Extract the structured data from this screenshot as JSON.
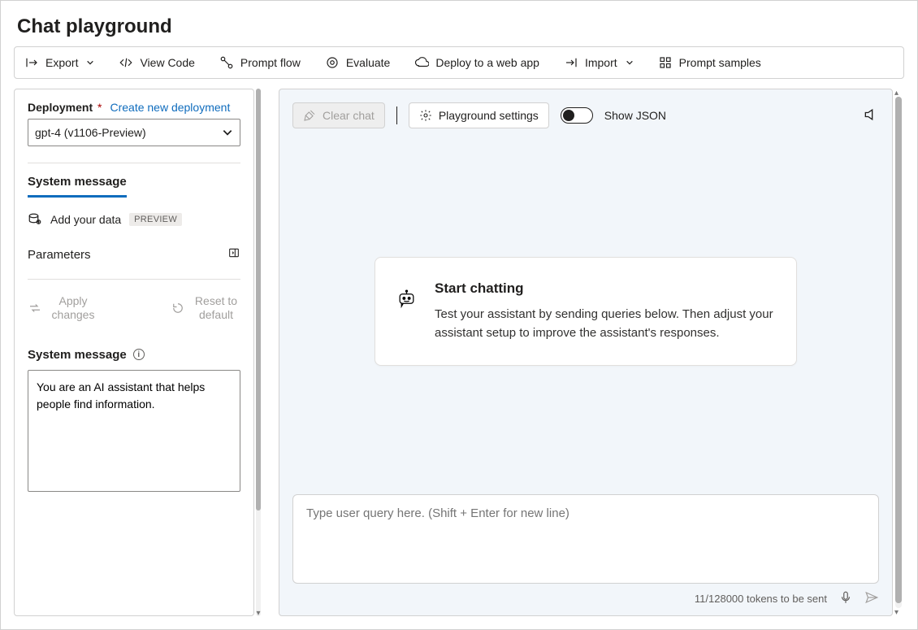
{
  "pageTitle": "Chat playground",
  "toolbar": {
    "export": "Export",
    "viewCode": "View Code",
    "promptFlow": "Prompt flow",
    "evaluate": "Evaluate",
    "deploy": "Deploy to a web app",
    "import": "Import",
    "promptSamples": "Prompt samples"
  },
  "left": {
    "deploymentLabel": "Deployment",
    "createLink": "Create new deployment",
    "selectedModel": "gpt-4 (v1106-Preview)",
    "systemMessageTab": "System message",
    "addYourData": "Add your data",
    "previewBadge": "PREVIEW",
    "parameters": "Parameters",
    "applyChanges": "Apply changes",
    "resetDefault": "Reset to default",
    "systemMessageLabel": "System message",
    "systemMessageValue": "You are an AI assistant that helps people find information."
  },
  "right": {
    "clearChat": "Clear chat",
    "playgroundSettings": "Playground settings",
    "showJson": "Show JSON",
    "startTitle": "Start chatting",
    "startBody": "Test your assistant by sending queries below. Then adjust your assistant setup to improve the assistant's responses.",
    "inputPlaceholder": "Type user query here. (Shift + Enter for new line)",
    "tokenStatus": "11/128000 tokens to be sent"
  }
}
